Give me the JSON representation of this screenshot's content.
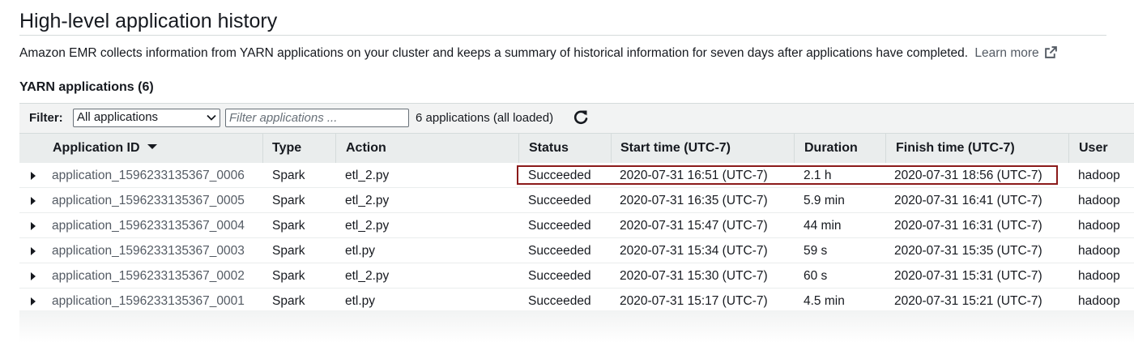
{
  "page": {
    "title": "High-level application history",
    "description": "Amazon EMR collects information from YARN applications on your cluster and keeps a summary of historical information for seven days after applications have completed.",
    "learn_more": "Learn more"
  },
  "section": {
    "title": "YARN applications (6)"
  },
  "filter": {
    "label": "Filter:",
    "select_value": "All applications",
    "input_placeholder": "Filter applications ...",
    "count_text": "6 applications (all loaded)"
  },
  "table": {
    "columns": [
      "Application ID",
      "Type",
      "Action",
      "Status",
      "Start time (UTC-7)",
      "Duration",
      "Finish time (UTC-7)",
      "User"
    ],
    "sorted_column": "Application ID",
    "sort_direction": "descending",
    "rows": [
      {
        "id": "application_1596233135367_0006",
        "type": "Spark",
        "action": "etl_2.py",
        "status": "Succeeded",
        "start": "2020-07-31 16:51 (UTC-7)",
        "duration": "2.1 h",
        "finish": "2020-07-31 18:56 (UTC-7)",
        "user": "hadoop",
        "highlighted": true
      },
      {
        "id": "application_1596233135367_0005",
        "type": "Spark",
        "action": "etl_2.py",
        "status": "Succeeded",
        "start": "2020-07-31 16:35 (UTC-7)",
        "duration": "5.9 min",
        "finish": "2020-07-31 16:41 (UTC-7)",
        "user": "hadoop"
      },
      {
        "id": "application_1596233135367_0004",
        "type": "Spark",
        "action": "etl_2.py",
        "status": "Succeeded",
        "start": "2020-07-31 15:47 (UTC-7)",
        "duration": "44 min",
        "finish": "2020-07-31 16:31 (UTC-7)",
        "user": "hadoop"
      },
      {
        "id": "application_1596233135367_0003",
        "type": "Spark",
        "action": "etl.py",
        "status": "Succeeded",
        "start": "2020-07-31 15:34 (UTC-7)",
        "duration": "59 s",
        "finish": "2020-07-31 15:35 (UTC-7)",
        "user": "hadoop"
      },
      {
        "id": "application_1596233135367_0002",
        "type": "Spark",
        "action": "etl_2.py",
        "status": "Succeeded",
        "start": "2020-07-31 15:30 (UTC-7)",
        "duration": "60 s",
        "finish": "2020-07-31 15:31 (UTC-7)",
        "user": "hadoop"
      },
      {
        "id": "application_1596233135367_0001",
        "type": "Spark",
        "action": "etl.py",
        "status": "Succeeded",
        "start": "2020-07-31 15:17 (UTC-7)",
        "duration": "4.5 min",
        "finish": "2020-07-31 15:21 (UTC-7)",
        "user": "hadoop"
      }
    ]
  },
  "colors": {
    "highlight_border": "#8b1a1a",
    "link_text": "#545b64",
    "panel_bg": "#f2f3f3",
    "header_bg": "#eaeded"
  },
  "icons": {
    "external_link": "external-link-icon",
    "refresh": "refresh-icon",
    "sort": "sort-descending-icon",
    "expand": "caret-right-icon",
    "dropdown": "chevron-down-icon"
  }
}
